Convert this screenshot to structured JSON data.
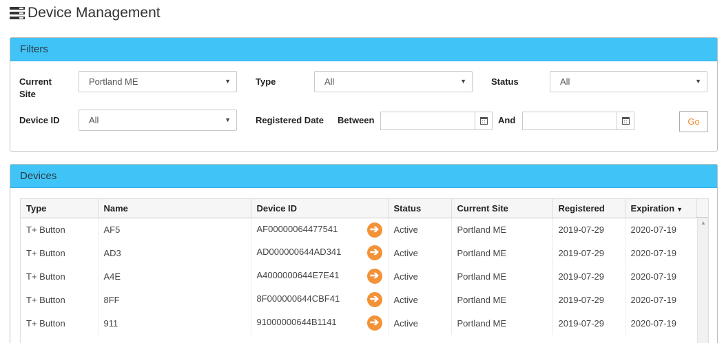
{
  "header": {
    "title": "Device Management",
    "icon": "server-icon"
  },
  "filters": {
    "heading": "Filters",
    "current_site_label": "Current Site",
    "current_site_value": "Portland ME",
    "type_label": "Type",
    "type_value": "All",
    "status_label": "Status",
    "status_value": "All",
    "device_id_label": "Device ID",
    "device_id_value": "All",
    "registered_date_label": "Registered Date",
    "between_label": "Between",
    "and_label": "And",
    "between_value": "",
    "and_value": "",
    "go_label": "Go"
  },
  "devices": {
    "heading": "Devices",
    "columns": [
      "Type",
      "Name",
      "Device ID",
      "Status",
      "Current Site",
      "Registered",
      "Expiration"
    ],
    "rows": [
      {
        "type": "T+ Button",
        "name": "AF5",
        "device_id": "AF00000064477541",
        "status": "Active",
        "site": "Portland ME",
        "registered": "2019-07-29",
        "expiration": "2020-07-19"
      },
      {
        "type": "T+ Button",
        "name": "AD3",
        "device_id": "AD000000644AD341",
        "status": "Active",
        "site": "Portland ME",
        "registered": "2019-07-29",
        "expiration": "2020-07-19"
      },
      {
        "type": "T+ Button",
        "name": "A4E",
        "device_id": "A4000000644E7E41",
        "status": "Active",
        "site": "Portland ME",
        "registered": "2019-07-29",
        "expiration": "2020-07-19"
      },
      {
        "type": "T+ Button",
        "name": "8FF",
        "device_id": "8F000000644CBF41",
        "status": "Active",
        "site": "Portland ME",
        "registered": "2019-07-29",
        "expiration": "2020-07-19"
      },
      {
        "type": "T+ Button",
        "name": "911",
        "device_id": "91000000644B1141",
        "status": "Active",
        "site": "Portland ME",
        "registered": "2019-07-29",
        "expiration": "2020-07-19"
      }
    ]
  },
  "colors": {
    "panel_heading": "#40c4f8",
    "accent": "#f39237"
  }
}
